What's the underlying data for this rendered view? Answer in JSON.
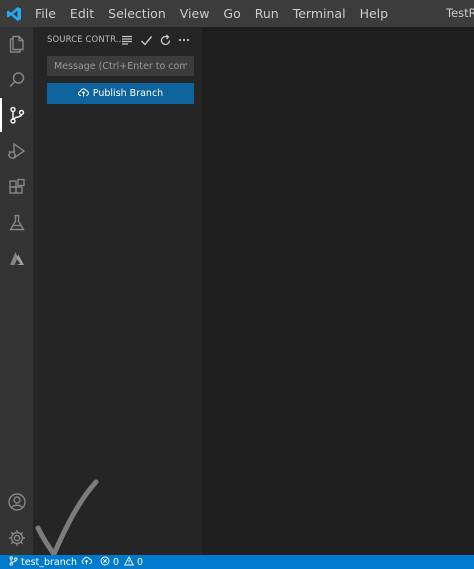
{
  "titlebar": {
    "menu": [
      {
        "name": "menu-file",
        "label": "File"
      },
      {
        "name": "menu-edit",
        "label": "Edit"
      },
      {
        "name": "menu-selection",
        "label": "Selection"
      },
      {
        "name": "menu-view",
        "label": "View"
      },
      {
        "name": "menu-go",
        "label": "Go"
      },
      {
        "name": "menu-run",
        "label": "Run"
      },
      {
        "name": "menu-terminal",
        "label": "Terminal"
      },
      {
        "name": "menu-help",
        "label": "Help"
      }
    ],
    "window_title": "TestRe"
  },
  "activitybar": {
    "items": [
      {
        "name": "explorer-icon",
        "active": false
      },
      {
        "name": "search-icon",
        "active": false
      },
      {
        "name": "source-control-icon",
        "active": true
      },
      {
        "name": "run-debug-icon",
        "active": false
      },
      {
        "name": "extensions-icon",
        "active": false
      },
      {
        "name": "testing-icon",
        "active": false
      },
      {
        "name": "azure-icon",
        "active": false
      }
    ],
    "bottom_items": [
      {
        "name": "accounts-icon"
      },
      {
        "name": "manage-gear-icon"
      }
    ]
  },
  "sidebar": {
    "title": "SOURCE CONTR...",
    "toolbar_icons": [
      "view-as-tree-icon",
      "commit-check-icon",
      "refresh-icon",
      "more-actions-icon"
    ],
    "commit_message": {
      "value": "",
      "placeholder": "Message (Ctrl+Enter to comm..."
    },
    "publish_button": {
      "label": "Publish Branch",
      "icon": "cloud-upload-icon"
    }
  },
  "statusbar": {
    "branch_icon": "git-branch-icon",
    "branch": "test_branch",
    "publish_icon": "cloud-upload-icon",
    "errors_icon": "error-circle-icon",
    "errors": "0",
    "warnings_icon": "warning-triangle-icon",
    "warnings": "0"
  },
  "colors": {
    "titlebar": "#3c3c3c",
    "activitybar": "#333333",
    "sidebar": "#252526",
    "editor": "#1e1e1e",
    "statusbar": "#007acc",
    "button": "#0e639c",
    "vscode_blue": "#23a9f2"
  }
}
